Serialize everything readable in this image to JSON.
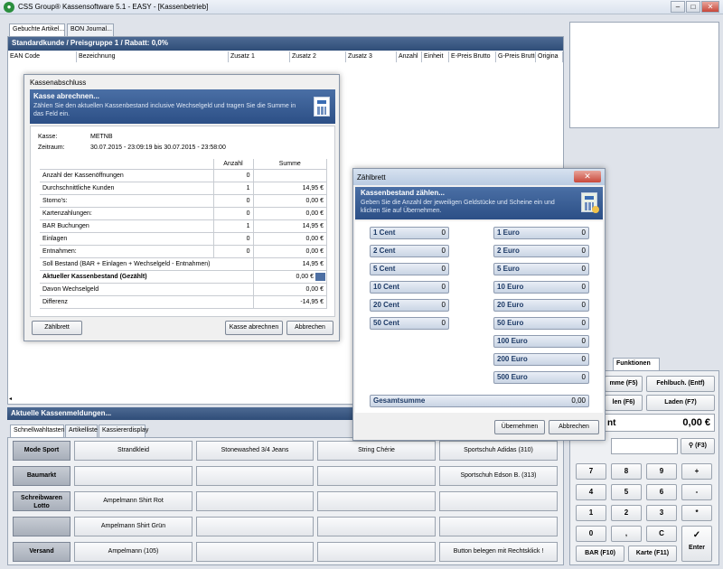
{
  "window": {
    "title": "CSS Group® Kassensoftware 5.1 - EASY - [Kassenbetrieb]",
    "min": "–",
    "max": "□",
    "close": "✕"
  },
  "top_tabs": [
    {
      "label": "Gebuchte Artikel..."
    },
    {
      "label": "BON Journal..."
    }
  ],
  "customer_bar": "Standardkunde / Preisgruppe 1 / Rabatt: 0,0%",
  "columns": [
    "EAN Code",
    "Bezeichnung",
    "Zusatz 1",
    "Zusatz 2",
    "Zusatz 3",
    "Anzahl",
    "Einheit",
    "E-Preis Brutto",
    "G-Preis Brutto",
    "Origina"
  ],
  "messages_bar": "Aktuelle Kassenmeldungen...",
  "bottom_tabs": [
    {
      "label": "Schnellwahltasten"
    },
    {
      "label": "Artikelliste"
    },
    {
      "label": "Kassiererdisplay"
    }
  ],
  "categories": [
    "Mode Sport",
    "Baumarkt",
    "Schreibwaren Lotto",
    "",
    "Versand"
  ],
  "quick_rows": [
    [
      "Strandkleid",
      "Stonewashed 3/4 Jeans",
      "String Chérie",
      "Sportschuh Adidas (310)"
    ],
    [
      "",
      "",
      "",
      "Sportschuh Edson B. (313)"
    ],
    [
      "Ampelmann Shirt Rot",
      "",
      "",
      ""
    ],
    [
      "Ampelmann Shirt Grün",
      "",
      "",
      ""
    ],
    [
      "Ampelmann (105)",
      "",
      "",
      "Button belegen mit Rechtsklick !"
    ]
  ],
  "kasse_dialog": {
    "window_title": "Kassenabschluss",
    "header": "Kasse abrechnen...",
    "subtitle": "Zählen Sie den aktuellen Kassenbestand inclusive Wechselgeld und tragen Sie die Summe in das Feld ein.",
    "kasse_label": "Kasse:",
    "kasse_value": "METNB",
    "zeitraum_label": "Zeitraum:",
    "zeitraum_value": "30.07.2015 - 23:09:19 bis 30.07.2015 - 23:58:00",
    "col_anzahl": "Anzahl",
    "col_summe": "Summe",
    "rows": [
      {
        "label": "Anzahl der Kassenöffnungen",
        "anzahl": "0",
        "summe": ""
      },
      {
        "label": "Durchschnittliche Kunden",
        "anzahl": "1",
        "summe": "14,95 €"
      },
      {
        "label": "Storno's:",
        "anzahl": "0",
        "summe": "0,00 €"
      },
      {
        "label": "Kartenzahlungen:",
        "anzahl": "0",
        "summe": "0,00 €"
      },
      {
        "label": "BAR Buchungen",
        "anzahl": "1",
        "summe": "14,95 €"
      },
      {
        "label": "Einlagen",
        "anzahl": "0",
        "summe": "0,00 €"
      },
      {
        "label": "Entnahmen:",
        "anzahl": "0",
        "summe": "0,00 €"
      },
      {
        "label": "Soll Bestand   (BAR + Einlagen + Wechselgeld - Entnahmen)",
        "anzahl": "",
        "summe": "14,95 €"
      },
      {
        "label": "Aktueller Kassenbestand (Gezählt)",
        "anzahl": "",
        "summe": "0,00 €"
      },
      {
        "label": "Davon Wechselgeld",
        "anzahl": "",
        "summe": "0,00 €"
      },
      {
        "label": "Differenz",
        "anzahl": "",
        "summe": "-14,95 €"
      }
    ],
    "btn_zaehlbrett": "Zählbrett",
    "btn_abrechnen": "Kasse abrechnen",
    "btn_abbrechen": "Abbrechen"
  },
  "zaehlbrett": {
    "window_title": "Zählbrett",
    "header": "Kassenbestand zählen...",
    "subtitle": "Geben Sie die Anzahl der jeweiligen Geldstücke und Scheine ein und klicken Sie auf Übernehmen.",
    "left": [
      {
        "label": "1 Cent",
        "value": "0"
      },
      {
        "label": "2 Cent",
        "value": "0"
      },
      {
        "label": "5 Cent",
        "value": "0"
      },
      {
        "label": "10 Cent",
        "value": "0"
      },
      {
        "label": "20 Cent",
        "value": "0"
      },
      {
        "label": "50 Cent",
        "value": "0"
      }
    ],
    "right": [
      {
        "label": "1 Euro",
        "value": "0"
      },
      {
        "label": "2 Euro",
        "value": "0"
      },
      {
        "label": "5 Euro",
        "value": "0"
      },
      {
        "label": "10 Euro",
        "value": "0"
      },
      {
        "label": "20 Euro",
        "value": "0"
      },
      {
        "label": "50 Euro",
        "value": "0"
      },
      {
        "label": "100 Euro",
        "value": "0"
      },
      {
        "label": "200 Euro",
        "value": "0"
      },
      {
        "label": "500 Euro",
        "value": "0"
      }
    ],
    "total_label": "Gesamtsumme",
    "total_value": "0,00",
    "btn_ok": "Übernehmen",
    "btn_cancel": "Abbrechen"
  },
  "right_panel": {
    "tab_funktionen": "Funktionen",
    "fbtns": [
      "mme (F5)",
      "Fehlbuch. (Entf)",
      "len (F6)",
      "Laden (F7)"
    ],
    "total_label": "nt",
    "total_value": "0,00 €",
    "search_btn": "(F3)",
    "keys": [
      [
        "7",
        "8",
        "9",
        "+"
      ],
      [
        "4",
        "5",
        "6",
        "-"
      ],
      [
        "1",
        "2",
        "3",
        "*"
      ],
      [
        "0",
        ",",
        "C"
      ]
    ],
    "enter": "Enter",
    "bar": "BAR (F10)",
    "karte": "Karte (F11)"
  }
}
